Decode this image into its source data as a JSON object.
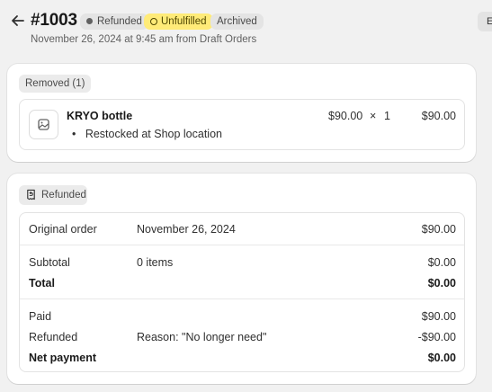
{
  "header": {
    "order_number": "#1003",
    "subtitle": "November 26, 2024 at 9:45 am from Draft Orders",
    "badges": {
      "payment": "Refunded",
      "fulfillment": "Unfulfilled",
      "archived": "Archived"
    },
    "edit_label": "E"
  },
  "removed_card": {
    "pill": "Removed (1)",
    "item": {
      "name": "KRYO bottle",
      "note": "Restocked at Shop location",
      "price": "$90.00",
      "times": "×",
      "quantity": "1",
      "total": "$90.00"
    }
  },
  "refund_card": {
    "pill": "Refunded",
    "original_order": {
      "label": "Original order",
      "date": "November 26, 2024",
      "amount": "$90.00"
    },
    "subtotal": {
      "label": "Subtotal",
      "detail": "0 items",
      "amount": "$0.00"
    },
    "total": {
      "label": "Total",
      "amount": "$0.00"
    },
    "paid": {
      "label": "Paid",
      "amount": "$90.00"
    },
    "refunded": {
      "label": "Refunded",
      "reason": "Reason: \"No longer need\"",
      "amount": "-$90.00"
    },
    "net_payment": {
      "label": "Net payment",
      "amount": "$0.00"
    }
  },
  "icons": {
    "back": "arrow-left-icon",
    "product": "image-placeholder-icon",
    "refund": "receipt-refund-icon"
  }
}
